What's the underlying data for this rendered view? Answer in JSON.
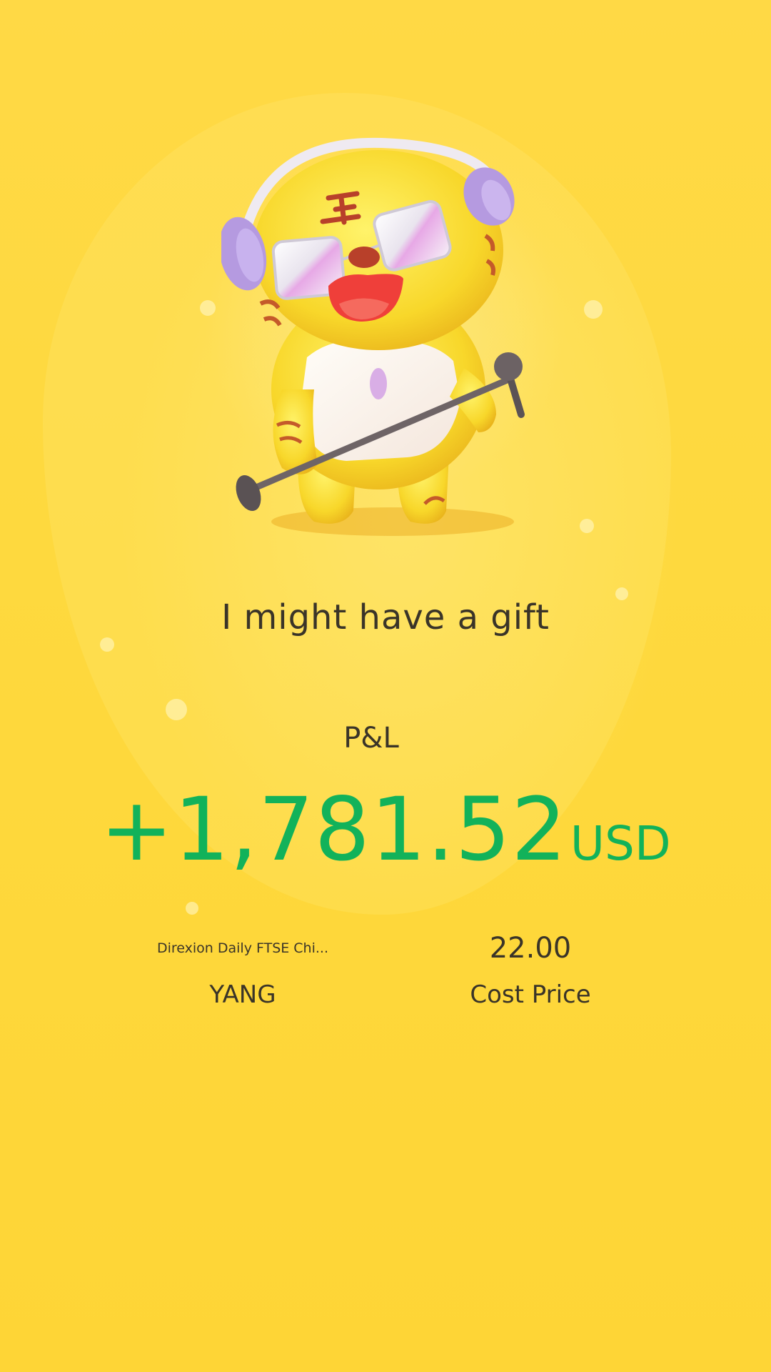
{
  "mascot": {
    "icon": "tiger-mascot-with-microphone-icon"
  },
  "headline": "I might have a gift",
  "pnl": {
    "label": "P&L",
    "amount": "+1,781.52",
    "currency": "USD",
    "color": "#12b25a"
  },
  "stock": {
    "name": "Direxion Daily FTSE Chi...",
    "symbol": "YANG"
  },
  "cost": {
    "value": "22.00",
    "label": "Cost Price"
  },
  "colors": {
    "background": "#fed93e",
    "text": "#3a3428",
    "profit": "#12b25a"
  }
}
